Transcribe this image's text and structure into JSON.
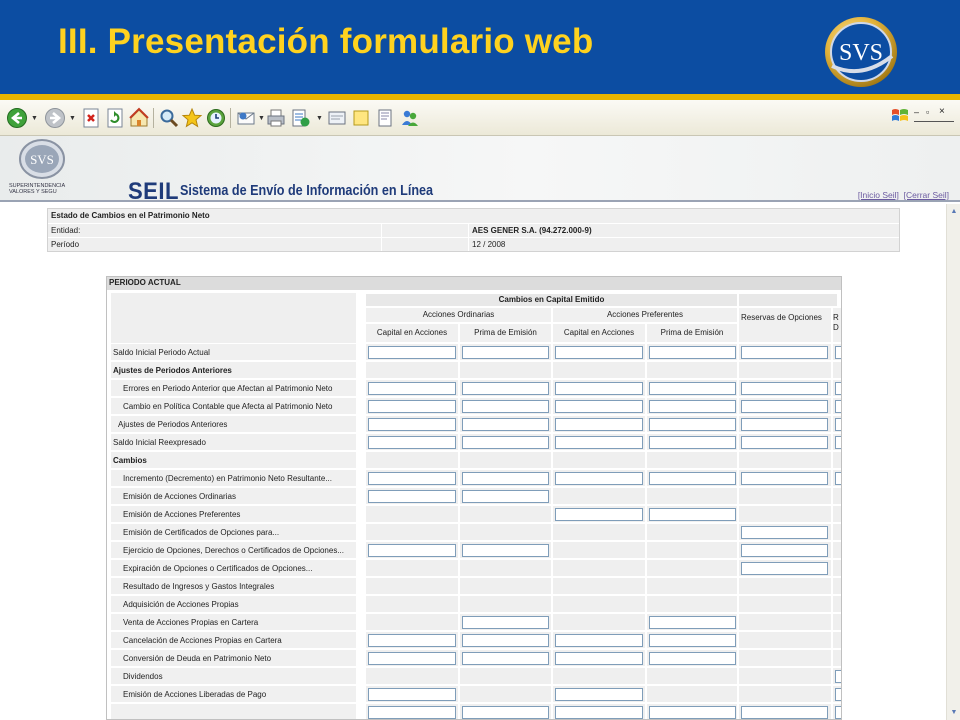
{
  "slide": {
    "title": "III. Presentación formulario web",
    "logo_text": "SVS",
    "colors": {
      "banner": "#0c4da2",
      "title": "#ffd21f",
      "accent_line": "#e8b400"
    }
  },
  "browser": {
    "toolbar_icons": [
      "back-icon",
      "forward-icon",
      "stop-icon",
      "refresh-icon",
      "home-icon",
      "search-icon",
      "favorites-icon",
      "history-icon",
      "mail-icon",
      "print-icon",
      "edit-icon",
      "discuss-icon",
      "messenger-icon",
      "research-icon",
      "windows-flag-icon"
    ]
  },
  "seil": {
    "mini_logo_text": "SVS",
    "agency_line1": "SUPERINTENDENCIA",
    "agency_line2": "VALORES Y SEGU",
    "brand": "SEIL",
    "subtitle": "Sistema de Envío de Información en Línea",
    "link_home": "[Inicio Seil]",
    "link_logout": "[Cerrar Seil]"
  },
  "info": {
    "title": "Estado de Cambios en el Patrimonio Neto",
    "entidad_label": "Entidad:",
    "entidad_value": "AES GENER S.A. (94.272.000-9)",
    "periodo_label": "Período",
    "periodo_value": "12 / 2008"
  },
  "table": {
    "section": "PERIODO ACTUAL",
    "group_header": "Cambios en Capital Emitido",
    "sub_ordinarias": "Acciones Ordinarias",
    "sub_preferentes": "Acciones Preferentes",
    "col1": "Capital en Acciones",
    "col2": "Prima de Emisión",
    "col3": "Capital en Acciones",
    "col4": "Prima de Emisión",
    "col5": "Reservas de Opciones",
    "col6": "R D",
    "rows": [
      {
        "label": "Saldo Inicial Periodo Actual",
        "bold": false,
        "indent": 0,
        "inputs": [
          1,
          1,
          1,
          1,
          1,
          1
        ]
      },
      {
        "label": "Ajustes de Periodos Anteriores",
        "bold": true,
        "indent": 0,
        "inputs": [
          0,
          0,
          0,
          0,
          0,
          0
        ]
      },
      {
        "label": "Errores en Periodo Anterior que Afectan al Patrimonio Neto",
        "bold": false,
        "indent": 2,
        "inputs": [
          1,
          1,
          1,
          1,
          1,
          1
        ]
      },
      {
        "label": "Cambio en Política Contable que Afecta al Patrimonio Neto",
        "bold": false,
        "indent": 2,
        "inputs": [
          1,
          1,
          1,
          1,
          1,
          1
        ]
      },
      {
        "label": "Ajustes de Periodos Anteriores",
        "bold": false,
        "indent": 1,
        "inputs": [
          1,
          1,
          1,
          1,
          1,
          1
        ]
      },
      {
        "label": "Saldo Inicial Reexpresado",
        "bold": false,
        "indent": 0,
        "inputs": [
          1,
          1,
          1,
          1,
          1,
          1
        ]
      },
      {
        "label": "Cambios",
        "bold": true,
        "indent": 0,
        "inputs": [
          0,
          0,
          0,
          0,
          0,
          0
        ]
      },
      {
        "label": "Incremento (Decremento) en Patrimonio Neto Resultante...",
        "bold": false,
        "indent": 2,
        "inputs": [
          1,
          1,
          1,
          1,
          1,
          1
        ]
      },
      {
        "label": "Emisión de Acciones Ordinarias",
        "bold": false,
        "indent": 2,
        "inputs": [
          1,
          1,
          0,
          0,
          0,
          0
        ]
      },
      {
        "label": "Emisión de Acciones Preferentes",
        "bold": false,
        "indent": 2,
        "inputs": [
          0,
          0,
          1,
          1,
          0,
          0
        ]
      },
      {
        "label": "Emisión de Certificados de Opciones para...",
        "bold": false,
        "indent": 2,
        "inputs": [
          0,
          0,
          0,
          0,
          1,
          0
        ]
      },
      {
        "label": "Ejercicio de Opciones, Derechos o Certificados de Opciones...",
        "bold": false,
        "indent": 2,
        "inputs": [
          1,
          1,
          0,
          0,
          1,
          0
        ]
      },
      {
        "label": "Expiración de Opciones o Certificados de Opciones...",
        "bold": false,
        "indent": 2,
        "inputs": [
          0,
          0,
          0,
          0,
          1,
          0
        ]
      },
      {
        "label": "Resultado de Ingresos y Gastos Integrales",
        "bold": false,
        "indent": 2,
        "inputs": [
          0,
          0,
          0,
          0,
          0,
          0
        ]
      },
      {
        "label": "Adquisición de Acciones Propias",
        "bold": false,
        "indent": 2,
        "inputs": [
          0,
          0,
          0,
          0,
          0,
          0
        ]
      },
      {
        "label": "Venta de Acciones Propias en Cartera",
        "bold": false,
        "indent": 2,
        "inputs": [
          0,
          1,
          0,
          1,
          0,
          0
        ]
      },
      {
        "label": "Cancelación de Acciones Propias en Cartera",
        "bold": false,
        "indent": 2,
        "inputs": [
          1,
          1,
          1,
          1,
          0,
          0
        ]
      },
      {
        "label": "Conversión de Deuda en Patrimonio Neto",
        "bold": false,
        "indent": 2,
        "inputs": [
          1,
          1,
          1,
          1,
          0,
          0
        ]
      },
      {
        "label": "Dividendos",
        "bold": false,
        "indent": 2,
        "inputs": [
          0,
          0,
          0,
          0,
          0,
          1
        ]
      },
      {
        "label": "Emisión de Acciones Liberadas de Pago",
        "bold": false,
        "indent": 2,
        "inputs": [
          1,
          0,
          1,
          0,
          0,
          1
        ]
      },
      {
        "label": "",
        "bold": false,
        "indent": 2,
        "inputs": [
          1,
          1,
          1,
          1,
          1,
          1
        ]
      }
    ]
  }
}
